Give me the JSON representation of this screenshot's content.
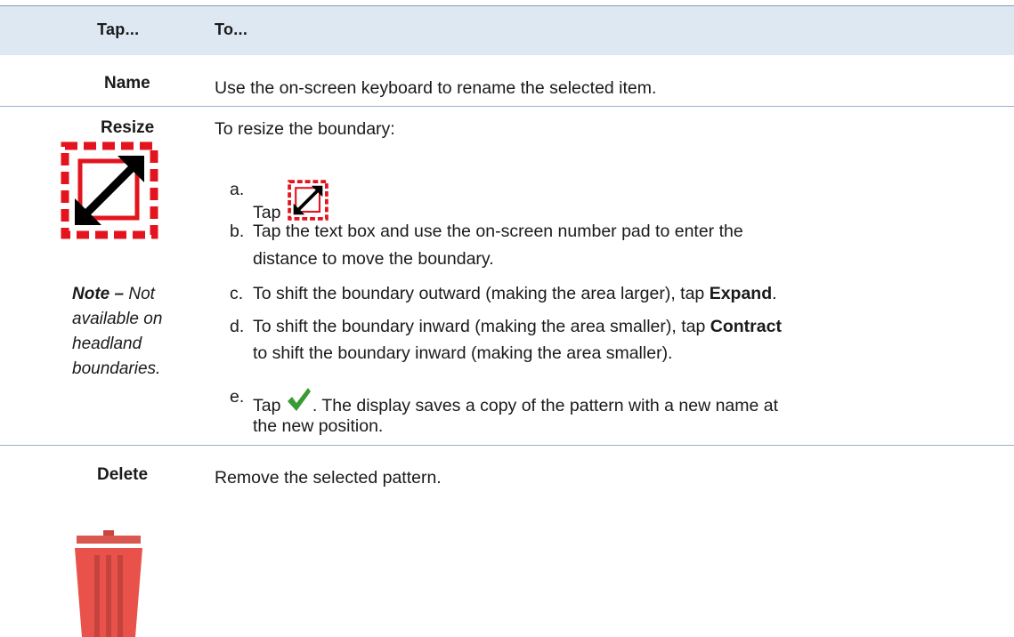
{
  "header": {
    "col1": "Tap...",
    "col2": "To..."
  },
  "rows": {
    "name": {
      "label": "Name",
      "description": "Use the on-screen keyboard to rename the selected item."
    },
    "resize": {
      "label": "Resize",
      "note_label": "Note –",
      "note_text": "Not available on headland boundaries.",
      "intro": "To resize the boundary:",
      "steps": [
        {
          "letter": "a.",
          "text": "Tap"
        },
        {
          "letter": "b.",
          "line1": "Tap the text box and use the on-screen number pad to enter the",
          "line2": "distance to move the boundary."
        },
        {
          "letter": "c.",
          "pre": "To shift the boundary outward (making the area larger), tap ",
          "bold": "Expand",
          "post": "."
        },
        {
          "letter": "d.",
          "pre": "To shift the boundary inward (making the area smaller), tap ",
          "bold": "Contract",
          "line2": "to shift the boundary inward (making the area smaller)."
        },
        {
          "letter": "e.",
          "pre": "Tap ",
          "post": ". The display saves a copy of the pattern with a new name at",
          "line2": "the new position."
        }
      ]
    },
    "delete": {
      "label": "Delete",
      "description": "Remove the selected pattern."
    }
  },
  "icons": {
    "resize": "resize-icon",
    "confirm": "checkmark-icon",
    "delete": "trash-icon",
    "colors": {
      "red": "#e3141d",
      "green": "#3a9a35",
      "trash": "#e8524a"
    }
  }
}
